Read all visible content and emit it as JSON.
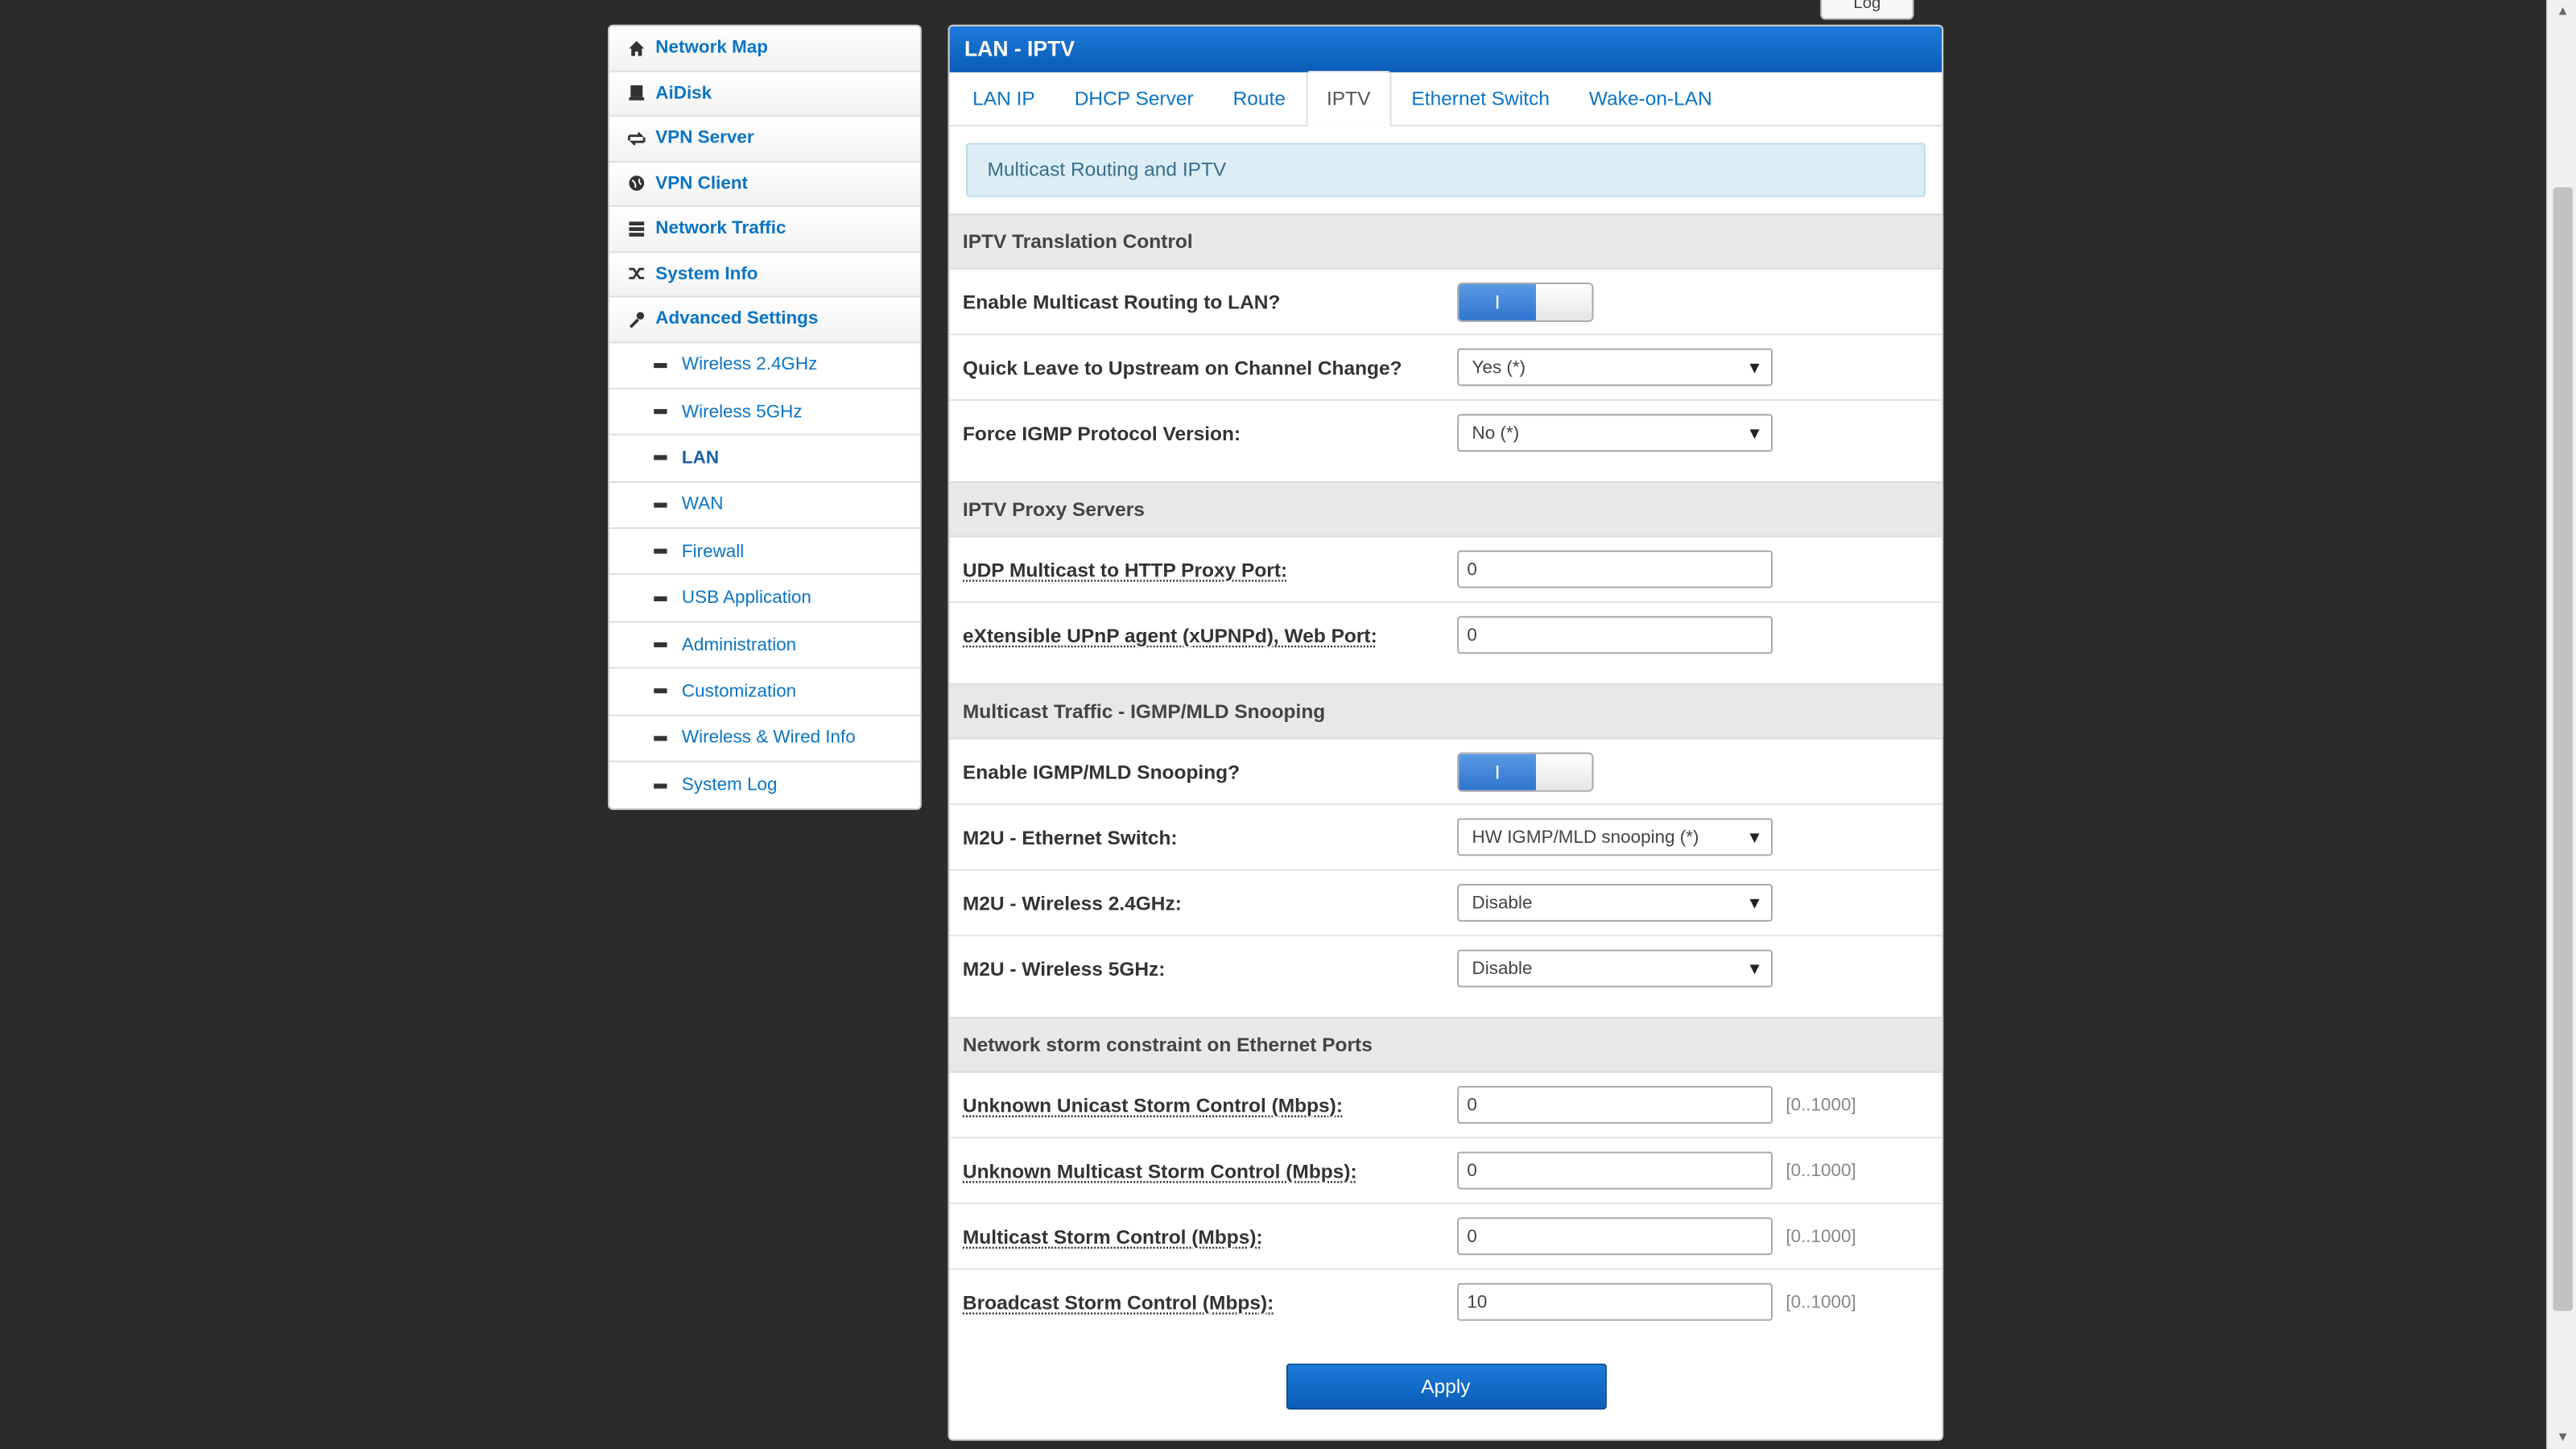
{
  "top": {
    "log_label": "Log"
  },
  "sidebar": {
    "items": [
      {
        "label": "Network Map",
        "icon": "home-icon"
      },
      {
        "label": "AiDisk",
        "icon": "disk-icon"
      },
      {
        "label": "VPN Server",
        "icon": "vpn-server-icon"
      },
      {
        "label": "VPN Client",
        "icon": "globe-icon"
      },
      {
        "label": "Network Traffic",
        "icon": "traffic-icon"
      },
      {
        "label": "System Info",
        "icon": "shuffle-icon"
      },
      {
        "label": "Advanced Settings",
        "icon": "wrench-icon"
      }
    ],
    "sub_items": [
      {
        "label": "Wireless 2.4GHz"
      },
      {
        "label": "Wireless 5GHz"
      },
      {
        "label": "LAN",
        "active": true
      },
      {
        "label": "WAN"
      },
      {
        "label": "Firewall"
      },
      {
        "label": "USB Application"
      },
      {
        "label": "Administration"
      },
      {
        "label": "Customization"
      },
      {
        "label": "Wireless & Wired Info"
      },
      {
        "label": "System Log"
      }
    ]
  },
  "panel": {
    "title": "LAN - IPTV",
    "tabs": [
      {
        "label": "LAN IP"
      },
      {
        "label": "DHCP Server"
      },
      {
        "label": "Route"
      },
      {
        "label": "IPTV",
        "active": true
      },
      {
        "label": "Ethernet Switch"
      },
      {
        "label": "Wake-on-LAN"
      }
    ],
    "info": "Multicast Routing and IPTV",
    "sections": {
      "translation": {
        "title": "IPTV Translation Control",
        "enable_multicast": {
          "label": "Enable Multicast Routing to LAN?",
          "state": "I"
        },
        "quick_leave": {
          "label": "Quick Leave to Upstream on Channel Change?",
          "value": "Yes (*)"
        },
        "force_igmp": {
          "label": "Force IGMP Protocol Version:",
          "value": "No (*)"
        }
      },
      "proxy": {
        "title": "IPTV Proxy Servers",
        "udpxy": {
          "label": "UDP Multicast to HTTP Proxy Port:",
          "value": "0"
        },
        "xupnpd": {
          "label": "eXtensible UPnP agent (xUPNPd), Web Port:",
          "value": "0"
        }
      },
      "snooping": {
        "title": "Multicast Traffic - IGMP/MLD Snooping",
        "enable_snooping": {
          "label": "Enable IGMP/MLD Snooping?",
          "state": "I"
        },
        "m2u_eth": {
          "label": "M2U - Ethernet Switch:",
          "value": "HW IGMP/MLD snooping (*)"
        },
        "m2u_24": {
          "label": "M2U - Wireless 2.4GHz:",
          "value": "Disable"
        },
        "m2u_5": {
          "label": "M2U - Wireless 5GHz:",
          "value": "Disable"
        }
      },
      "storm": {
        "title": "Network storm constraint on Ethernet Ports",
        "unicast": {
          "label": "Unknown Unicast Storm Control (Mbps):",
          "value": "0",
          "range": "[0..1000]"
        },
        "unk_multicast": {
          "label": "Unknown Multicast Storm Control (Mbps):",
          "value": "0",
          "range": "[0..1000]"
        },
        "multicast": {
          "label": "Multicast Storm Control (Mbps):",
          "value": "0",
          "range": "[0..1000]"
        },
        "broadcast": {
          "label": "Broadcast Storm Control (Mbps):",
          "value": "10",
          "range": "[0..1000]"
        }
      }
    },
    "apply_label": "Apply"
  },
  "colors": {
    "accent": "#0b5cb8",
    "link": "#0a74c7",
    "background": "#2b2b2b"
  }
}
